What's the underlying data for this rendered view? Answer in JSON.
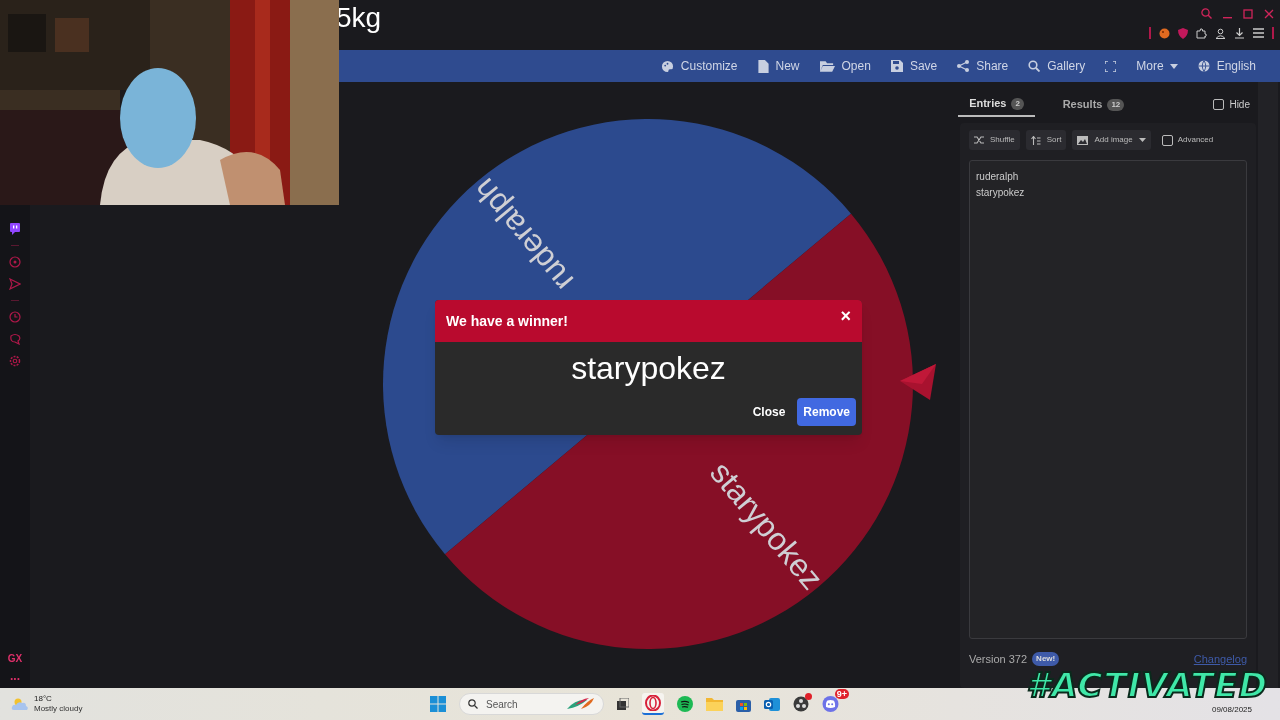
{
  "page_title": "5kg",
  "sidebar": {
    "bottom_label": "GX",
    "more": "..."
  },
  "toolbar": {
    "actions": [
      "Customize",
      "New",
      "Open",
      "Save",
      "Share",
      "Gallery"
    ],
    "more": "More",
    "language": "English"
  },
  "wheel": {
    "segments": [
      {
        "label": "ruderalph",
        "color": "#2c4a8e"
      },
      {
        "label": "starypokez",
        "color": "#860f26"
      }
    ]
  },
  "dialog": {
    "title": "We have a winner!",
    "close": "×",
    "winner": "starypokez",
    "buttons": [
      {
        "label": "Close",
        "primary": false
      },
      {
        "label": "Remove",
        "primary": true
      }
    ]
  },
  "panel": {
    "tabs": [
      {
        "label": "Entries",
        "count": "2",
        "selected": true
      },
      {
        "label": "Results",
        "count": "12",
        "selected": false
      }
    ],
    "hide": {
      "label": "Hide",
      "checked": false
    },
    "tools": {
      "shuffle": "Shuffle",
      "sort": "Sort",
      "add_image": "Add image",
      "advanced": {
        "label": "Advanced",
        "checked": false
      }
    },
    "entries": [
      "ruderalph",
      "starypokez"
    ],
    "footer": {
      "version": "Version 372",
      "badge": "New!",
      "link": "Changelog"
    }
  },
  "overlay_text": "#ACTIVATED",
  "taskbar": {
    "weather": {
      "temp": "18°C",
      "condition": "Mostly cloudy"
    },
    "search_placeholder": "Search",
    "discord_badge": "9+",
    "date": "09/08/2025"
  }
}
